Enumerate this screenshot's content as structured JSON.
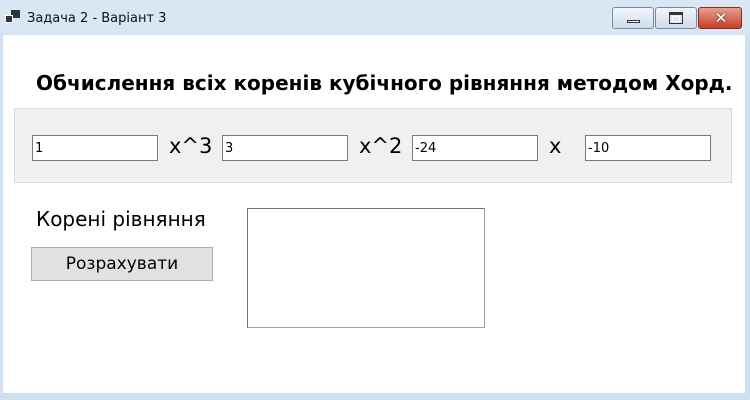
{
  "window": {
    "title": "Задача 2 - Варіант 3",
    "controls": {
      "minimize": "minimize",
      "maximize": "maximize",
      "close": "✕"
    }
  },
  "form": {
    "heading": "Обчислення всіх коренів кубічного рівняння методом Хорд.",
    "coefficients": [
      {
        "value": "1",
        "term": "x^3"
      },
      {
        "value": "3",
        "term": "x^2"
      },
      {
        "value": "-24",
        "term": "x"
      },
      {
        "value": "-10",
        "term": ""
      }
    ],
    "roots_label": "Корені рівняння",
    "calculate_button": "Розрахувати",
    "roots_output": ""
  },
  "colors": {
    "titlebar": "#d9e7f5",
    "close_button": "#c43f28",
    "panel": "#f0f0f0",
    "button": "#e1e1e1"
  }
}
